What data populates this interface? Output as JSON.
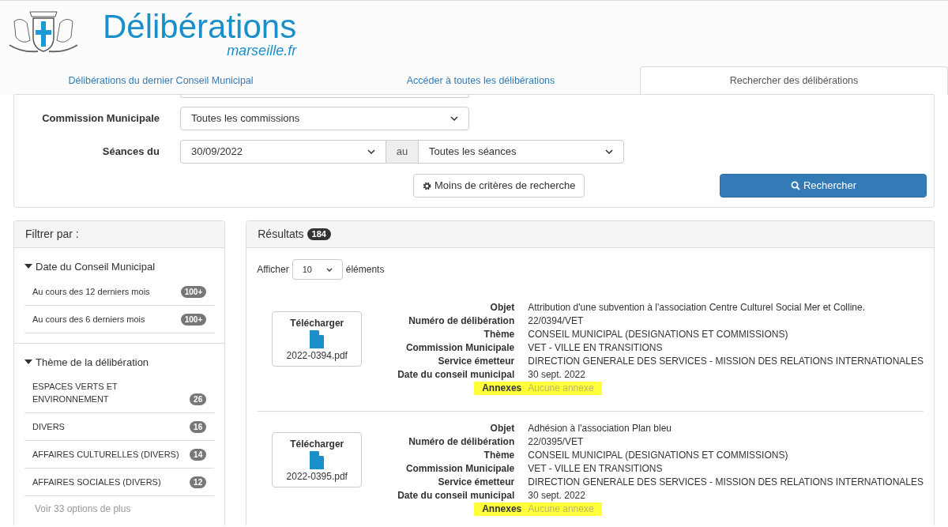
{
  "header": {
    "title": "Délibérations",
    "subtitle": "marseille.fr"
  },
  "tabs": [
    {
      "label": "Délibérations du dernier Conseil Municipal",
      "selected": false
    },
    {
      "label": "Accéder à toutes les délibérations",
      "selected": false
    },
    {
      "label": "Rechercher des délibérations",
      "selected": true
    }
  ],
  "search_form": {
    "commission": {
      "label": "Commission Municipale",
      "value": "Toutes les commissions"
    },
    "seances": {
      "label": "Séances du",
      "from": "30/09/2022",
      "separator": "au",
      "to": "Toutes les séances"
    },
    "less_criteria_button": "Moins de critères de recherche",
    "search_button": "Rechercher"
  },
  "filters": {
    "title": "Filtrer par :",
    "groups": [
      {
        "title": "Date du Conseil Municipal",
        "expanded": true,
        "items": [
          {
            "label": "Au cours des 12 derniers mois",
            "count": "100+"
          },
          {
            "label": "Au cours des 6 derniers mois",
            "count": "100+"
          }
        ]
      },
      {
        "title": "Thème de la délibération",
        "expanded": true,
        "items": [
          {
            "label": "ESPACES VERTS ET ENVIRONNEMENT",
            "count": "26"
          },
          {
            "label": "DIVERS",
            "count": "16"
          },
          {
            "label": "AFFAIRES CULTURELLES (DIVERS)",
            "count": "14"
          },
          {
            "label": "AFFAIRES SOCIALES (DIVERS)",
            "count": "12"
          }
        ],
        "more": "Voir 33 options de plus"
      }
    ]
  },
  "results": {
    "title": "Résultats",
    "count": "184",
    "show_label": "Afficher",
    "page_size": "10",
    "show_suffix": "éléments",
    "items": [
      {
        "download_label": "Télécharger",
        "file": "2022-0394.pdf",
        "fields": [
          {
            "label": "Objet",
            "value": "Attribution d'une subvention à l'association Centre Culturel Social Mer et Colline.",
            "highlighted": false
          },
          {
            "label": "Numéro de délibération",
            "value": "22/0394/VET",
            "highlighted": false
          },
          {
            "label": "Thème",
            "value": "CONSEIL MUNICIPAL (DESIGNATIONS ET COMMISSIONS)",
            "highlighted": false
          },
          {
            "label": "Commission Municipale",
            "value": "VET - VILLE EN TRANSITIONS",
            "highlighted": false
          },
          {
            "label": "Service émetteur",
            "value": "DIRECTION GENERALE DES SERVICES - MISSION DES RELATIONS INTERNATIONALES",
            "highlighted": false
          },
          {
            "label": "Date du conseil municipal",
            "value": "30 sept. 2022",
            "highlighted": false
          },
          {
            "label": "Annexes",
            "value": "Aucune annexe",
            "highlighted": true
          }
        ]
      },
      {
        "download_label": "Télécharger",
        "file": "2022-0395.pdf",
        "fields": [
          {
            "label": "Objet",
            "value": "Adhésion à l'association Plan bleu",
            "highlighted": false
          },
          {
            "label": "Numéro de délibération",
            "value": "22/0395/VET",
            "highlighted": false
          },
          {
            "label": "Thème",
            "value": "CONSEIL MUNICIPAL (DESIGNATIONS ET COMMISSIONS)",
            "highlighted": false
          },
          {
            "label": "Commission Municipale",
            "value": "VET - VILLE EN TRANSITIONS",
            "highlighted": false
          },
          {
            "label": "Service émetteur",
            "value": "DIRECTION GENERALE DES SERVICES - MISSION DES RELATIONS INTERNATIONALES",
            "highlighted": false
          },
          {
            "label": "Date du conseil municipal",
            "value": "30 sept. 2022",
            "highlighted": false
          },
          {
            "label": "Annexes",
            "value": "Aucune annexe",
            "highlighted": true
          }
        ]
      }
    ]
  }
}
